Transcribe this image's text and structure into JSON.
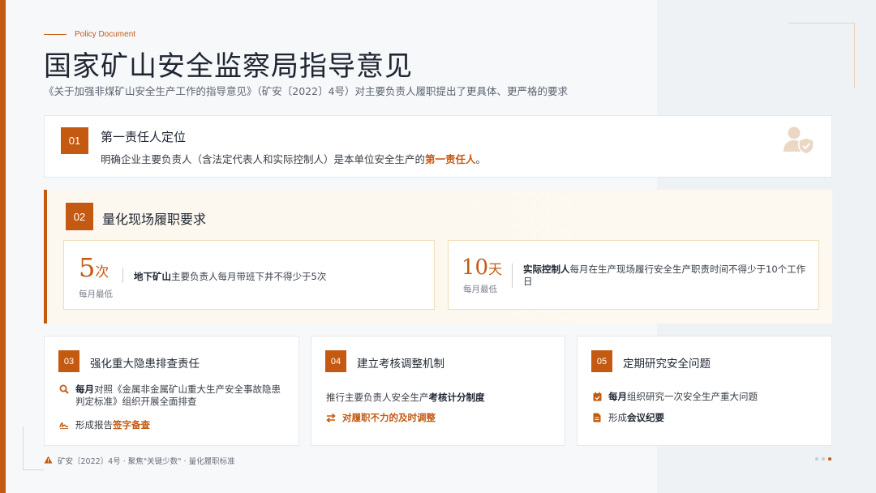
{
  "eyebrow": "Policy Document",
  "title": "国家矿山安全监察局指导意见",
  "subtitle": "《关于加强非煤矿山安全生产工作的指导意见》（矿安〔2022〕4号）对主要负责人履职提出了更具体、更严格的要求",
  "card1": {
    "num": "01",
    "heading": "第一责任人定位",
    "desc_prefix": "明确企业主要负责人（含法定代表人和实际控制人）是本单位安全生产的",
    "desc_highlight": "第一责任人",
    "desc_suffix": "。",
    "icon": "user-shield-icon"
  },
  "card2": {
    "num": "02",
    "heading": "量化现场履职要求",
    "item1": {
      "value": "5",
      "unit": "次",
      "caption": "每月最低",
      "desc_bold": "地下矿山",
      "desc_rest": "主要负责人每月带班下井不得少于5次"
    },
    "item2": {
      "value": "10",
      "unit": "天",
      "caption": "每月最低",
      "desc_bold": "实际控制人",
      "desc_rest": "每月在生产现场履行安全生产职责时间不得少于10个工作日"
    }
  },
  "card3": {
    "num": "03",
    "heading": "强化重大隐患排查责任",
    "row1_bold": "每月",
    "row1_rest": "对照《金属非金属矿山重大生产安全事故隐患判定标准》组织开展全面排查",
    "row2_prefix": "形成报告",
    "row2_highlight": "签字备查"
  },
  "card4": {
    "num": "04",
    "heading": "建立考核调整机制",
    "line1_prefix": "推行主要负责人安全生产",
    "line1_bold": "考核计分制度",
    "line2_highlight": "对履职不力的及时调整"
  },
  "card5": {
    "num": "05",
    "heading": "定期研究安全问题",
    "row1_bold": "每月",
    "row1_rest": "组织研究一次安全生产重大问题",
    "row2_prefix": "形成",
    "row2_bold": "会议纪要"
  },
  "footer": "矿安〔2022〕4号 · 聚焦\"关键少数\" · 量化履职标准",
  "colors": {
    "accent": "#c45a12",
    "text": "#1f2633"
  }
}
